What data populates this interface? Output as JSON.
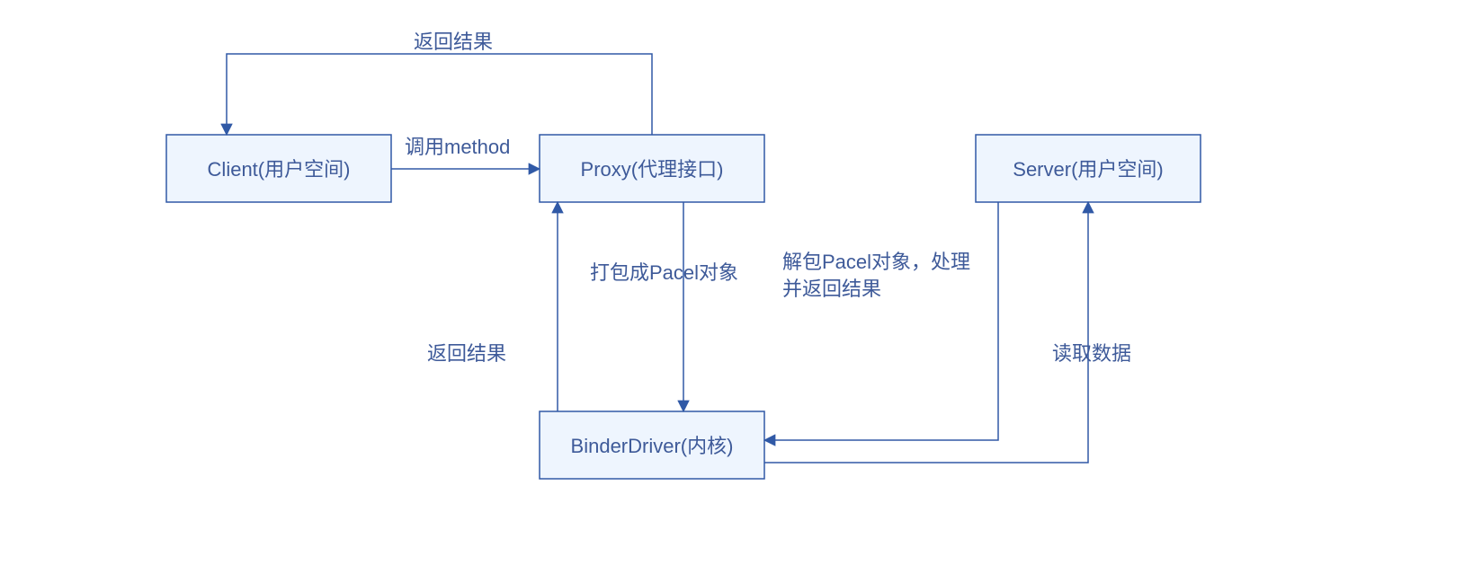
{
  "nodes": {
    "client": {
      "label": "Client(用户空间)"
    },
    "proxy": {
      "label": "Proxy(代理接口)"
    },
    "server": {
      "label": "Server(用户空间)"
    },
    "binder": {
      "label": "BinderDriver(内核)"
    }
  },
  "edges": {
    "client_to_proxy": {
      "label": "调用method"
    },
    "proxy_to_client_top": {
      "label": "返回结果"
    },
    "proxy_to_binder": {
      "label": "打包成Pacel对象"
    },
    "binder_to_proxy": {
      "label": "返回结果"
    },
    "binder_to_server": {
      "label": "读取数据"
    },
    "server_to_binder_line1": {
      "label": "解包Pacel对象，处理"
    },
    "server_to_binder_line2": {
      "label": "并返回结果"
    }
  },
  "colors": {
    "box_fill": "#EEF5FE",
    "stroke": "#3059A6",
    "text": "#3E5A99"
  }
}
